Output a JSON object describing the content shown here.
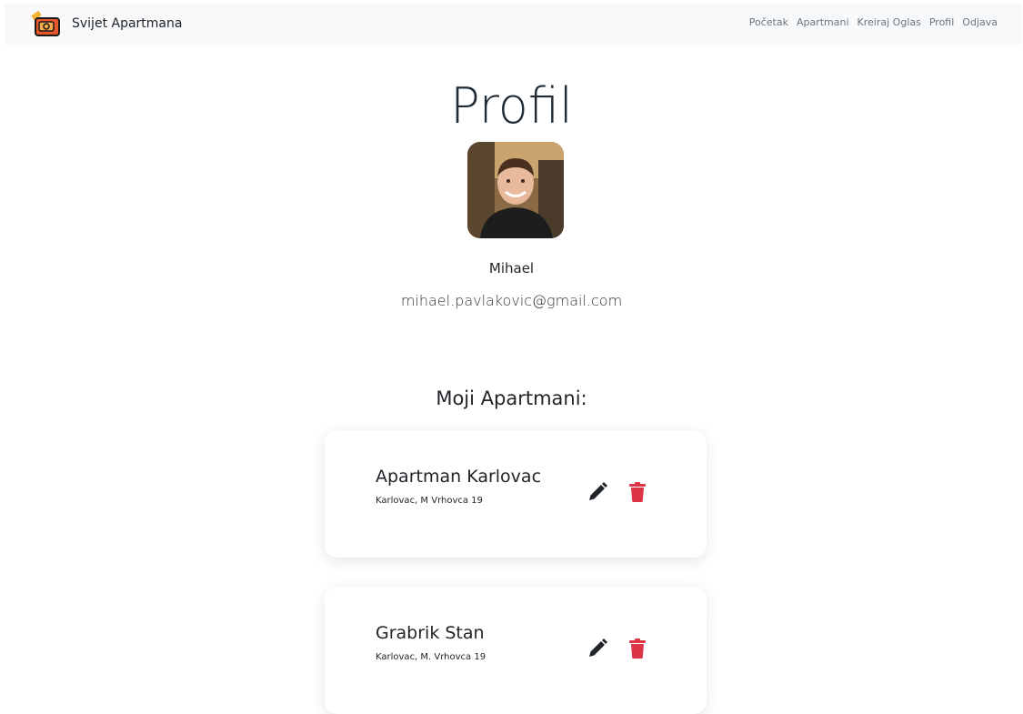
{
  "navbar": {
    "brand": "Svijet Apartmana",
    "links": [
      "Početak",
      "Apartmani",
      "Kreiraj Oglas",
      "Profil",
      "Odjava"
    ]
  },
  "profile": {
    "title": "Profil",
    "username": "Mihael",
    "email": "mihael.pavlakovic@gmail.com"
  },
  "apartments": {
    "heading": "Moji Apartmani:",
    "items": [
      {
        "name": "Apartman Karlovac",
        "address": "Karlovac, M Vrhovca 19"
      },
      {
        "name": "Grabrik Stan",
        "address": "Karlovac, M. Vrhovca 19"
      }
    ]
  },
  "colors": {
    "delete": "#dc3545",
    "edit": "#212529",
    "navbar_bg": "#f8f9fa"
  }
}
